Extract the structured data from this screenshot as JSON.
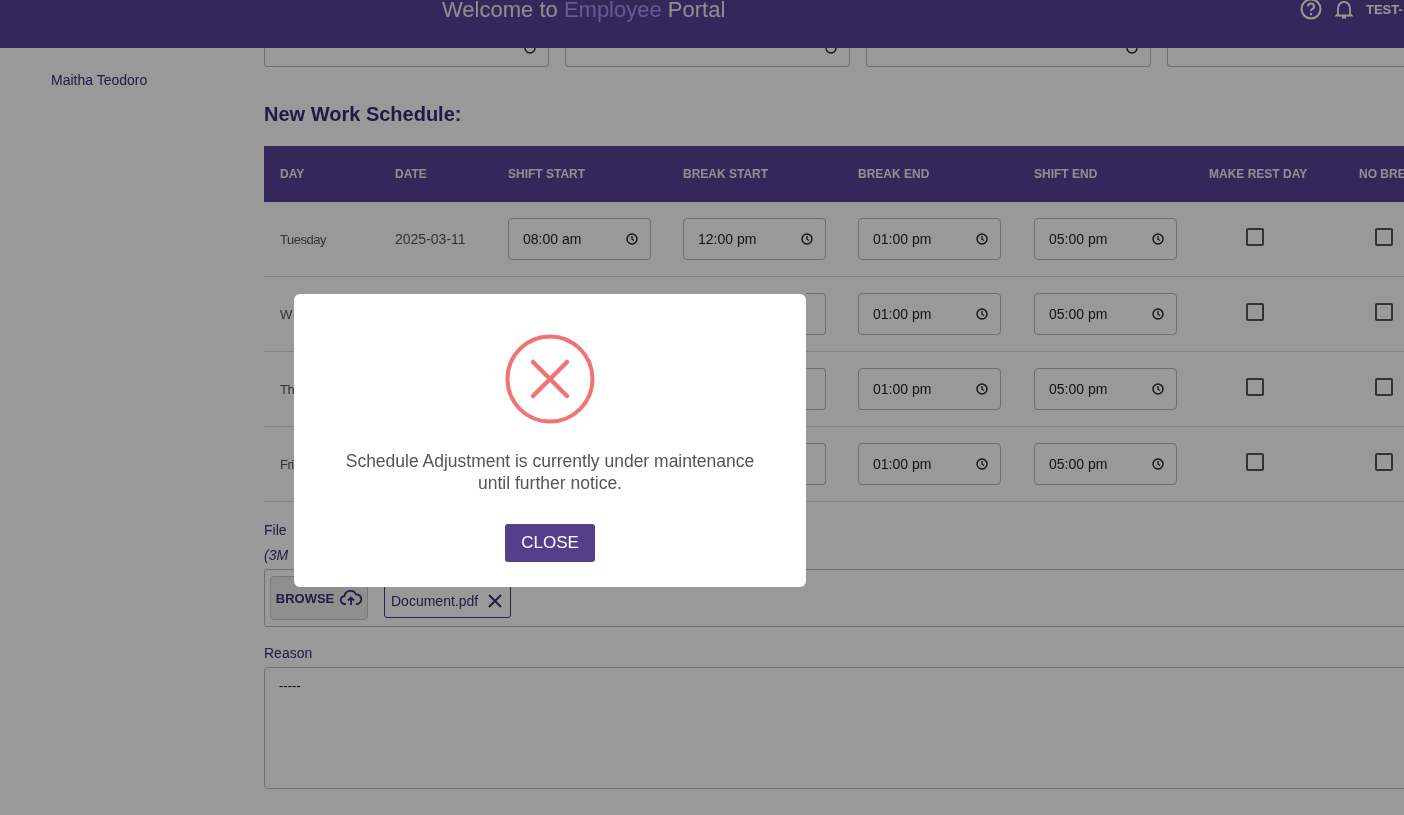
{
  "header": {
    "title_start": "Welcome to",
    "title_highlight": "Employee",
    "title_end": "Portal",
    "user": "TEST-"
  },
  "sidebar": {
    "employee_name": "Maitha Teodoro"
  },
  "current_schedule_fields": [
    {
      "kind": "time"
    },
    {
      "kind": "time"
    },
    {
      "kind": "time"
    },
    {
      "kind": "time"
    }
  ],
  "new_schedule": {
    "heading": "New Work Schedule:",
    "columns": [
      "DAY",
      "DATE",
      "SHIFT START",
      "BREAK START",
      "BREAK END",
      "SHIFT END",
      "MAKE REST DAY",
      "NO BRE"
    ],
    "rows": [
      {
        "day": "Tuesday",
        "date": "2025-03-11",
        "shift_start": "08:00 am",
        "break_start": "12:00 pm",
        "break_end": "01:00 pm",
        "shift_end": "05:00 pm",
        "make_rest_day": false,
        "no_break": false
      },
      {
        "day": "W",
        "break_end": "01:00 pm",
        "shift_end": "05:00 pm",
        "make_rest_day": false,
        "no_break": false
      },
      {
        "day": "Th",
        "break_end": "01:00 pm",
        "shift_end": "05:00 pm",
        "make_rest_day": false,
        "no_break": false
      },
      {
        "day": "Fri",
        "break_end": "01:00 pm",
        "shift_end": "05:00 pm",
        "make_rest_day": false,
        "no_break": false
      }
    ]
  },
  "attachment": {
    "label": "File",
    "hint": "(3M",
    "browse_button": "BROWSE",
    "files": [
      "Document.pdf"
    ]
  },
  "reason": {
    "label": "Reason",
    "value": "-----"
  },
  "dialog": {
    "message": "Schedule Adjustment is currently under maintenance until further notice.",
    "button": "CLOSE"
  }
}
